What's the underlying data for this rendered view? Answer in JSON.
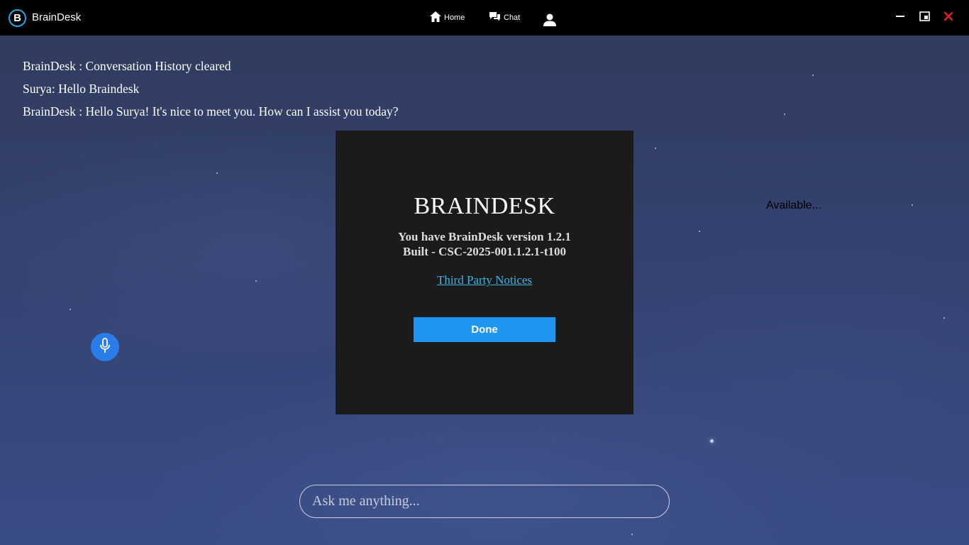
{
  "app": {
    "title": "BrainDesk",
    "logo_letter": "B"
  },
  "nav": {
    "home_label": "Home",
    "chat_label": "Chat"
  },
  "messages": [
    {
      "text": "BrainDesk : Conversation History cleared"
    },
    {
      "text": "Surya: Hello Braindesk"
    },
    {
      "text": "BrainDesk : Hello Surya! It's nice to meet you. How can I assist you today?"
    }
  ],
  "status": {
    "text": "Available..."
  },
  "dialog": {
    "brand": "BRAINDESK",
    "version_line": "You have BrainDesk version 1.2.1",
    "build_line": "Built - CSC-2025-001.1.2.1-t100",
    "link_label": "Third Party Notices",
    "done_label": "Done"
  },
  "input": {
    "placeholder": "Ask me anything..."
  },
  "colors": {
    "accent": "#1f97f2",
    "mic": "#2b7de9",
    "close": "#e02020",
    "link": "#3fb2e0",
    "dialog_bg": "#1b1b1b"
  },
  "icons": {
    "home": "home-icon",
    "chat": "chat-bubbles-icon",
    "user": "user-icon",
    "minimize": "minimize-icon",
    "restore": "restore-icon",
    "close": "close-icon",
    "mic": "microphone-icon"
  }
}
